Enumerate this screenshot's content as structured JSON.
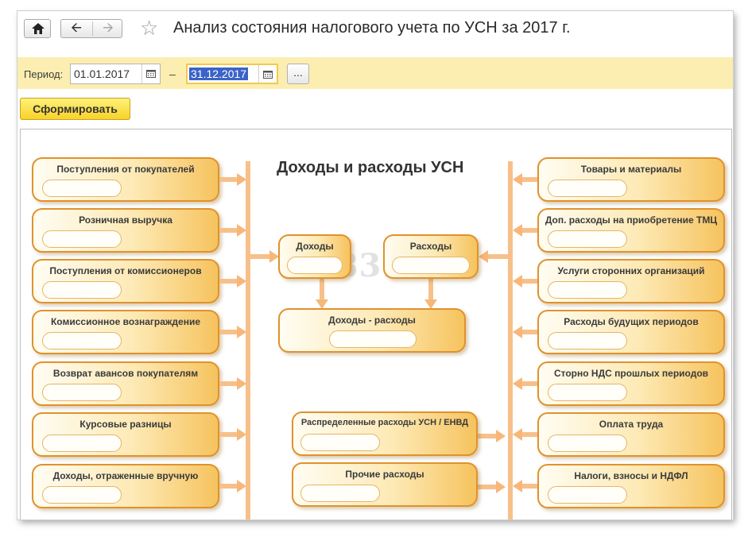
{
  "header": {
    "title": "Анализ состояния налогового учета по УСН за 2017 г.",
    "icons": [
      "home-icon",
      "back-arrow-icon",
      "forward-arrow-icon",
      "star-icon"
    ]
  },
  "period": {
    "label": "Период:",
    "from": "01.01.2017",
    "separator": "–",
    "to": "31.12.2017",
    "more_label": "..."
  },
  "actions": {
    "generate_label": "Сформировать"
  },
  "report": {
    "title": "Доходы и расходы УСН",
    "watermark": "1S83.info",
    "left_items": [
      "Поступления от покупателей",
      "Розничная выручка",
      "Поступления от комиссионеров",
      "Комиссионное вознаграждение",
      "Возврат авансов покупателям",
      "Курсовые разницы",
      "Доходы, отраженные вручную"
    ],
    "center": {
      "income": "Доходы",
      "expenses": "Расходы",
      "difference": "Доходы - расходы",
      "distributed": "Распределенные расходы УСН / ЕНВД",
      "other": "Прочие расходы"
    },
    "right_items": [
      "Товары и материалы",
      "Доп. расходы на приобретение ТМЦ",
      "Услуги сторонних организаций",
      "Расходы будущих периодов",
      "Сторно НДС прошлых периодов",
      "Оплата труда",
      "Налоги, взносы и НДФЛ"
    ]
  },
  "colors": {
    "accent_yellow": "#f7d22a",
    "period_bar": "#fbeeb0",
    "box_border": "#e0922c",
    "connector": "#f7c08a",
    "selection": "#3b63c7"
  }
}
